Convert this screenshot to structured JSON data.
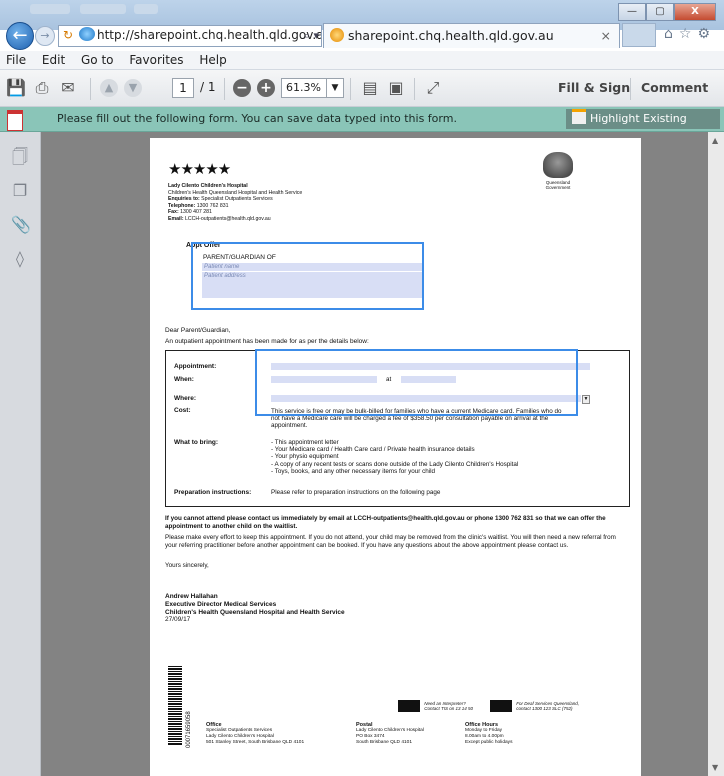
{
  "browser": {
    "address": "http://sharepoint.chq.health.qld.gov.au/",
    "address_host_bold": "qld.gov.au",
    "tab_title": "sharepoint.chq.health.qld.gov.au",
    "tab_close": "×",
    "window_controls": {
      "minimize": "—",
      "maximize": "▢",
      "close": "X"
    }
  },
  "menu": [
    "File",
    "Edit",
    "Go to",
    "Favorites",
    "Help"
  ],
  "pdf_toolbar": {
    "page_current": "1",
    "page_total": "/ 1",
    "zoom": "61.3%",
    "fill_sign": "Fill & Sign",
    "comment": "Comment"
  },
  "form_bar": {
    "message": "Please fill out the following form. You can save data typed into this form.",
    "highlight_label": "Highlight Existing Fields"
  },
  "document": {
    "org_lines": [
      "Lady Cilento Children's Hospital",
      "Children's Health Queensland Hospital and Health Service"
    ],
    "contact": [
      {
        "label": "Enquiries to:",
        "value": "Specialist Outpatients Services"
      },
      {
        "label": "Telephone:",
        "value": "1300 762 831"
      },
      {
        "label": "Fax:",
        "value": "1300 407 281"
      },
      {
        "label": "Email:",
        "value": "LCCH-outpatients@health.qld.gov.au"
      }
    ],
    "gov_label": "Queensland Government",
    "appt_title": "Appt Offer",
    "parent_label": "PARENT/GUARDIAN OF",
    "patient_name_ph": "Patient name",
    "patient_address_ph": "Patient address",
    "dear": "Dear Parent/Guardian,",
    "intro": "An outpatient appointment has been made for  as per the details below:",
    "rows": {
      "appointment": "Appointment:",
      "when": "When:",
      "at": "at",
      "where": "Where:",
      "cost": "Cost:",
      "cost_text": "This service is free or may be bulk-billed for families who have a current Medicare card. Families who do not have a Medicare care will be charged a fee of $358.50 per consultation payable on arrival at the appointment.",
      "bring": "What to bring:",
      "bring_items": [
        "- This appointment letter",
        "- Your Medicare card / Health Care card / Private health insurance details",
        "- Your physio equipment",
        "- A copy of any recent tests or scans done outside of the Lady Cilento Children's Hospital",
        "- Toys, books, and any other necessary items for your child"
      ],
      "prep": "Preparation instructions:",
      "prep_text": "Please refer to preparation instructions on the following page"
    },
    "contact_para": "If you cannot attend please contact us immediately by email at LCCH-outpatients@health.qld.gov.au or phone 1300 762 831 so that we can offer the appointment to another child on the waitlist.",
    "effort_para": "Please make every effort to keep this appointment. If you do not attend, your child may be removed from the clinic's waitlist. You will then need a new referral from your referring practitioner before another appointment can be booked. If you have any questions about the above appointment please contact us.",
    "sincerely": "Yours sincerely,",
    "sig_name": "Andrew Hallahan",
    "sig_title": "Executive Director Medical Services",
    "sig_org": "Children's Health Queensland Hospital and Health Service",
    "sig_date": "27/09/17",
    "barcode_num": "00071659058",
    "interpreter": [
      "Need an Interpreter?",
      "Contact TIS on 13 14 50"
    ],
    "deaf": [
      "For Deaf Services Queensland,",
      "contact 1300 123 SLC (752)"
    ],
    "footer": {
      "office": [
        "Office",
        "Specialist Outpatients Services",
        "Lady Cilento Children's Hospital",
        "501 Stanley Street, South Brisbane QLD 4101"
      ],
      "postal": [
        "Postal",
        "Lady Cilento Children's Hospital",
        "PO Box 3474",
        "South Brisbane QLD 4101"
      ],
      "hours": [
        "Office Hours",
        "Monday to Friday",
        "8.00am to 4.00pm",
        "Except public holidays"
      ]
    }
  }
}
